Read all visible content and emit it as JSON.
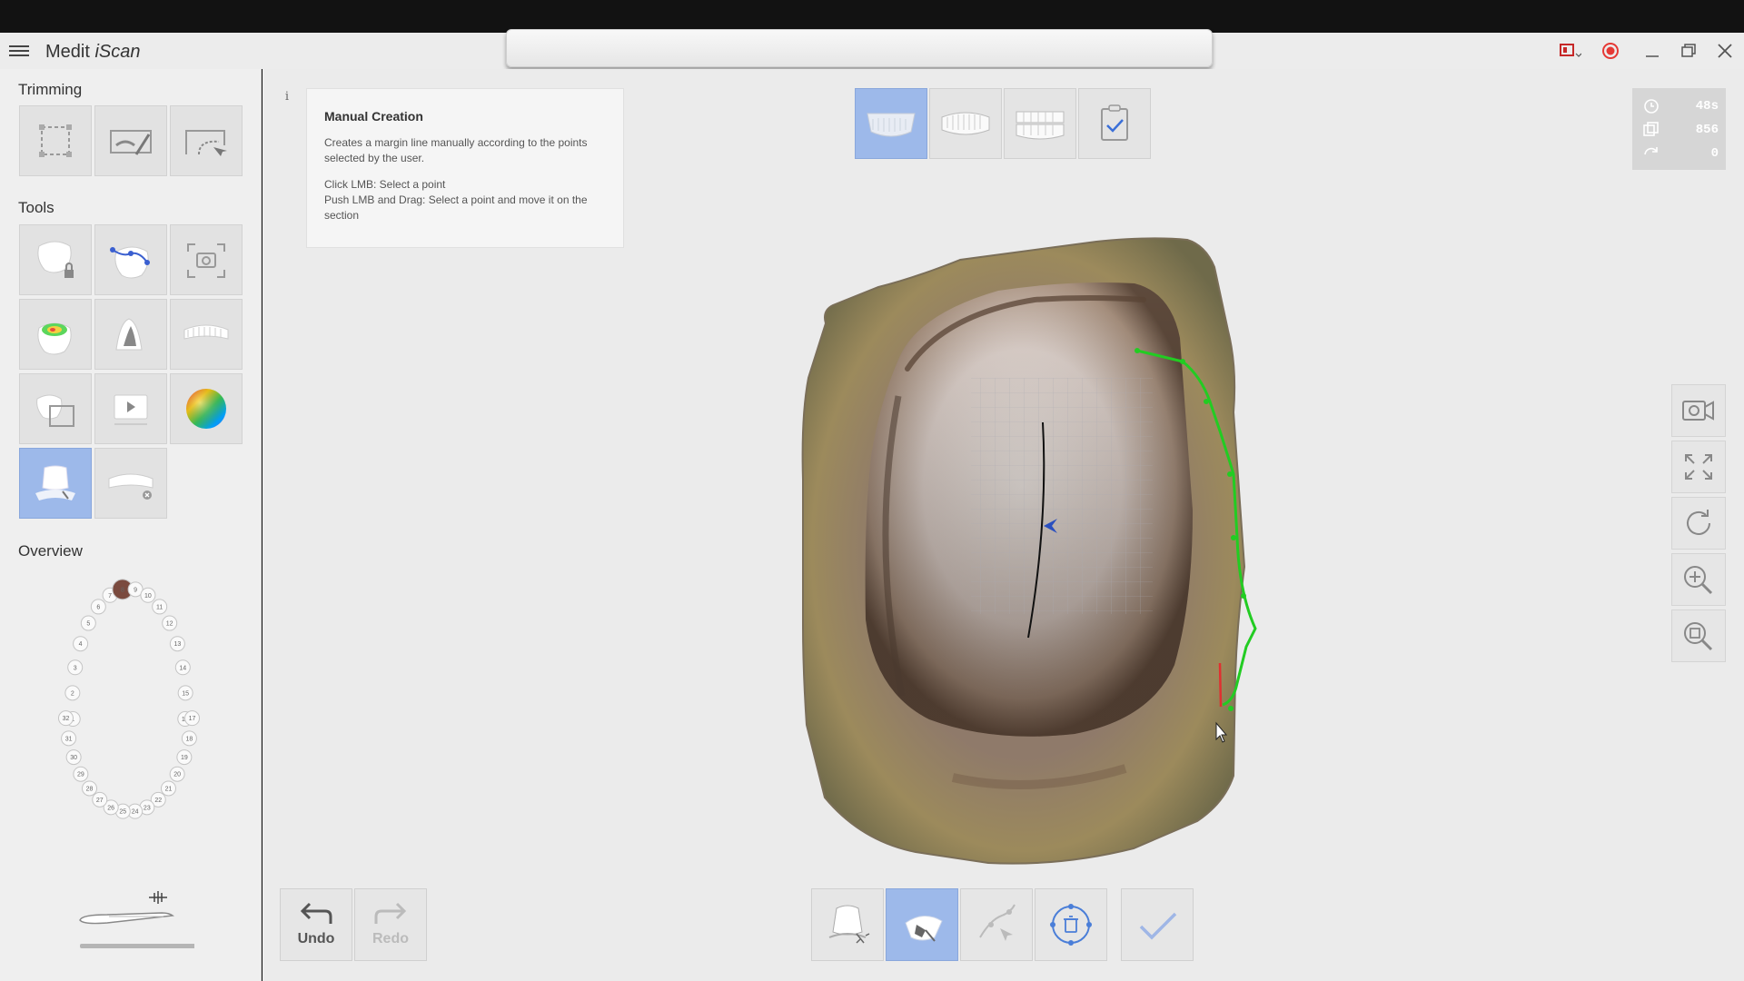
{
  "app": {
    "title_prefix": "Medit ",
    "title_suffix": "iScan"
  },
  "sidebar": {
    "trimming_label": "Trimming",
    "tools_label": "Tools",
    "overview_label": "Overview",
    "selected_tooth": "8",
    "teeth_upper": [
      "1",
      "2",
      "3",
      "4",
      "5",
      "6",
      "7",
      "8",
      "9",
      "10",
      "11",
      "12",
      "13",
      "14",
      "15",
      "16"
    ],
    "teeth_lower": [
      "17",
      "18",
      "19",
      "20",
      "21",
      "22",
      "23",
      "24",
      "25",
      "26",
      "27",
      "28",
      "29",
      "30",
      "31",
      "32"
    ]
  },
  "tooltip": {
    "title": "Manual Creation",
    "description": "Creates a margin line manually according to the points selected by the user.",
    "line1": "Click LMB: Select a point",
    "line2": "Push LMB and Drag: Select a point and move it on the section"
  },
  "stats": {
    "time": "48s",
    "count": "856",
    "third": "0"
  },
  "bottom": {
    "undo_label": "Undo",
    "redo_label": "Redo"
  },
  "colors": {
    "accent": "#9db9ea",
    "margin_line": "#22cc22",
    "record": "#e53935"
  }
}
